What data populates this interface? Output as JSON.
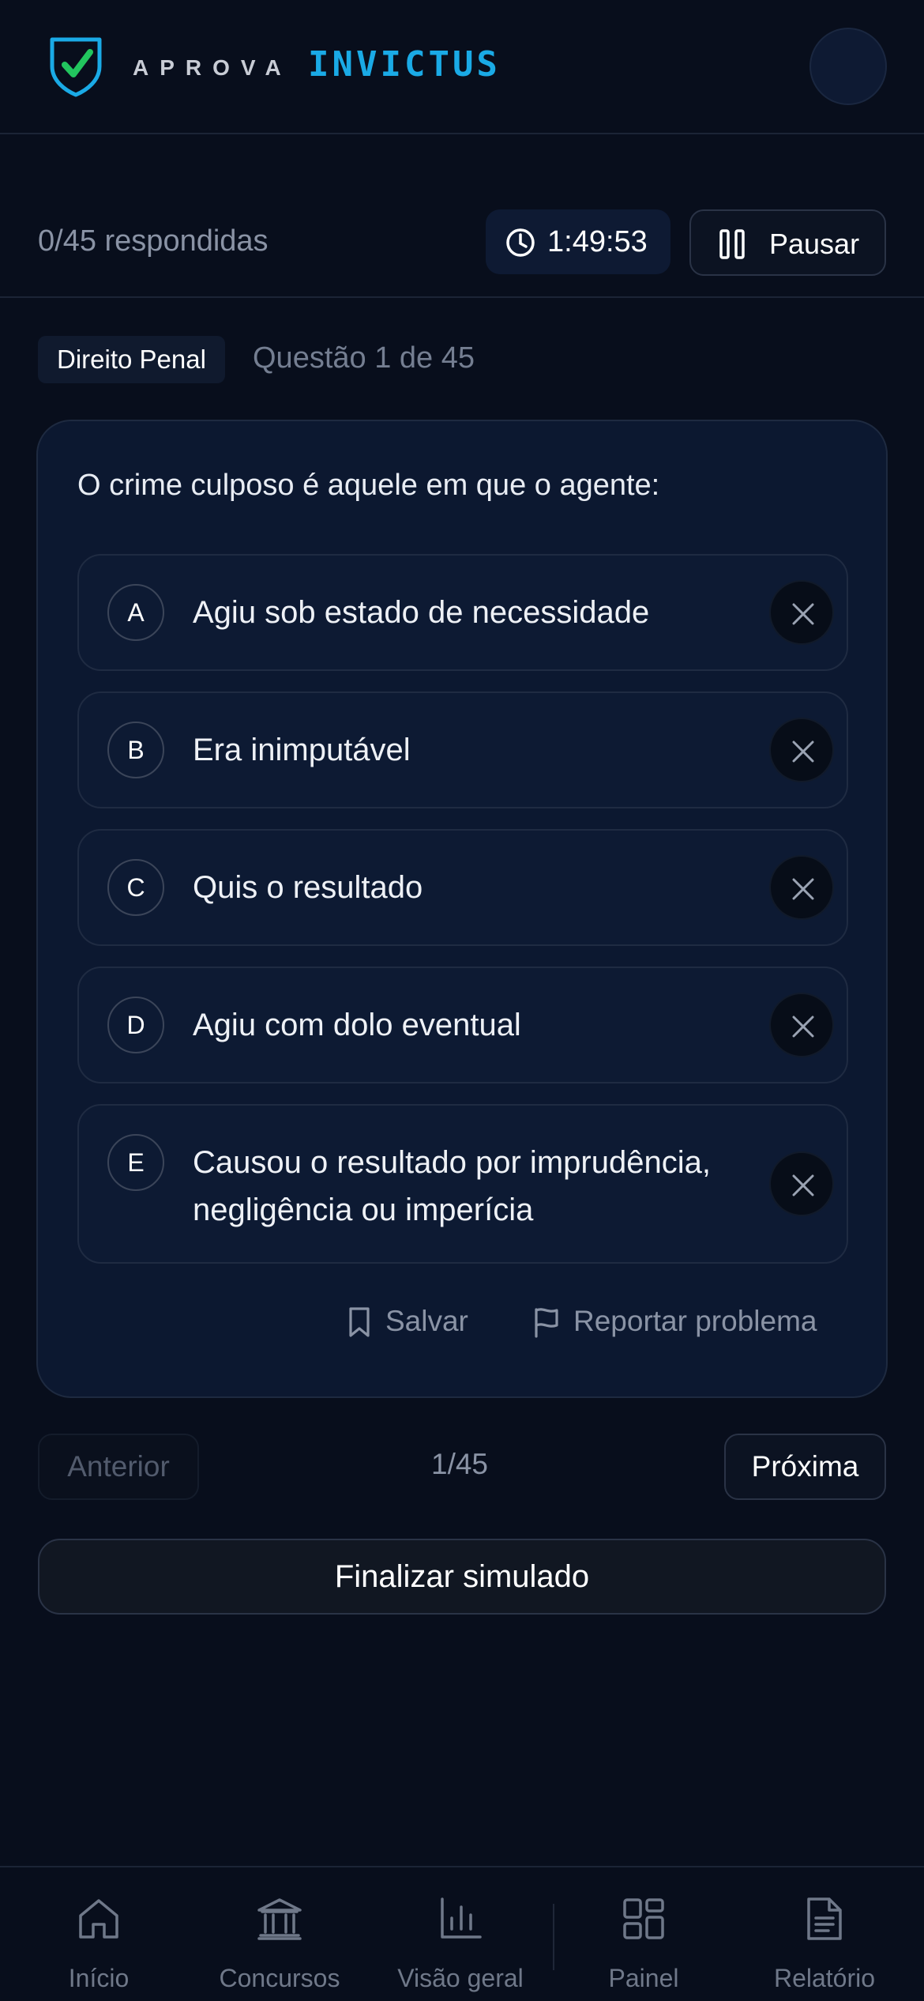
{
  "header": {
    "brand_primary": "APROVA",
    "brand_secondary": "INVICTUS"
  },
  "status": {
    "answered": "0/45 respondidas",
    "timer": "1:49:53",
    "pause_label": "Pausar"
  },
  "question": {
    "subject": "Direito Penal",
    "number_label": "Questão 1 de 45",
    "text": "O crime culposo é aquele em que o agente:",
    "options": [
      {
        "letter": "A",
        "text": "Agiu sob estado de necessidade"
      },
      {
        "letter": "B",
        "text": "Era inimputável"
      },
      {
        "letter": "C",
        "text": "Quis o resultado"
      },
      {
        "letter": "D",
        "text": "Agiu com dolo eventual"
      },
      {
        "letter": "E",
        "text_line1": "Causou o resultado por imprudência,",
        "text_line2": "negligência ou imperícia"
      }
    ],
    "save_label": "Salvar",
    "report_label": "Reportar problema"
  },
  "navigation": {
    "prev_label": "Anterior",
    "counter": "1/45",
    "next_label": "Próxima",
    "finish_label": "Finalizar simulado"
  },
  "bottom_nav": {
    "items": [
      {
        "label": "Início",
        "icon": "home-icon"
      },
      {
        "label": "Concursos",
        "icon": "bank-icon"
      },
      {
        "label": "Visão geral",
        "icon": "bar-chart-icon"
      },
      {
        "label": "Painel",
        "icon": "dashboard-icon"
      },
      {
        "label": "Relatório",
        "icon": "document-icon"
      }
    ]
  },
  "colors": {
    "background": "#080e1c",
    "card": "#0c1830",
    "accent_blue": "#1aaae6",
    "accent_green": "#22c55e"
  }
}
